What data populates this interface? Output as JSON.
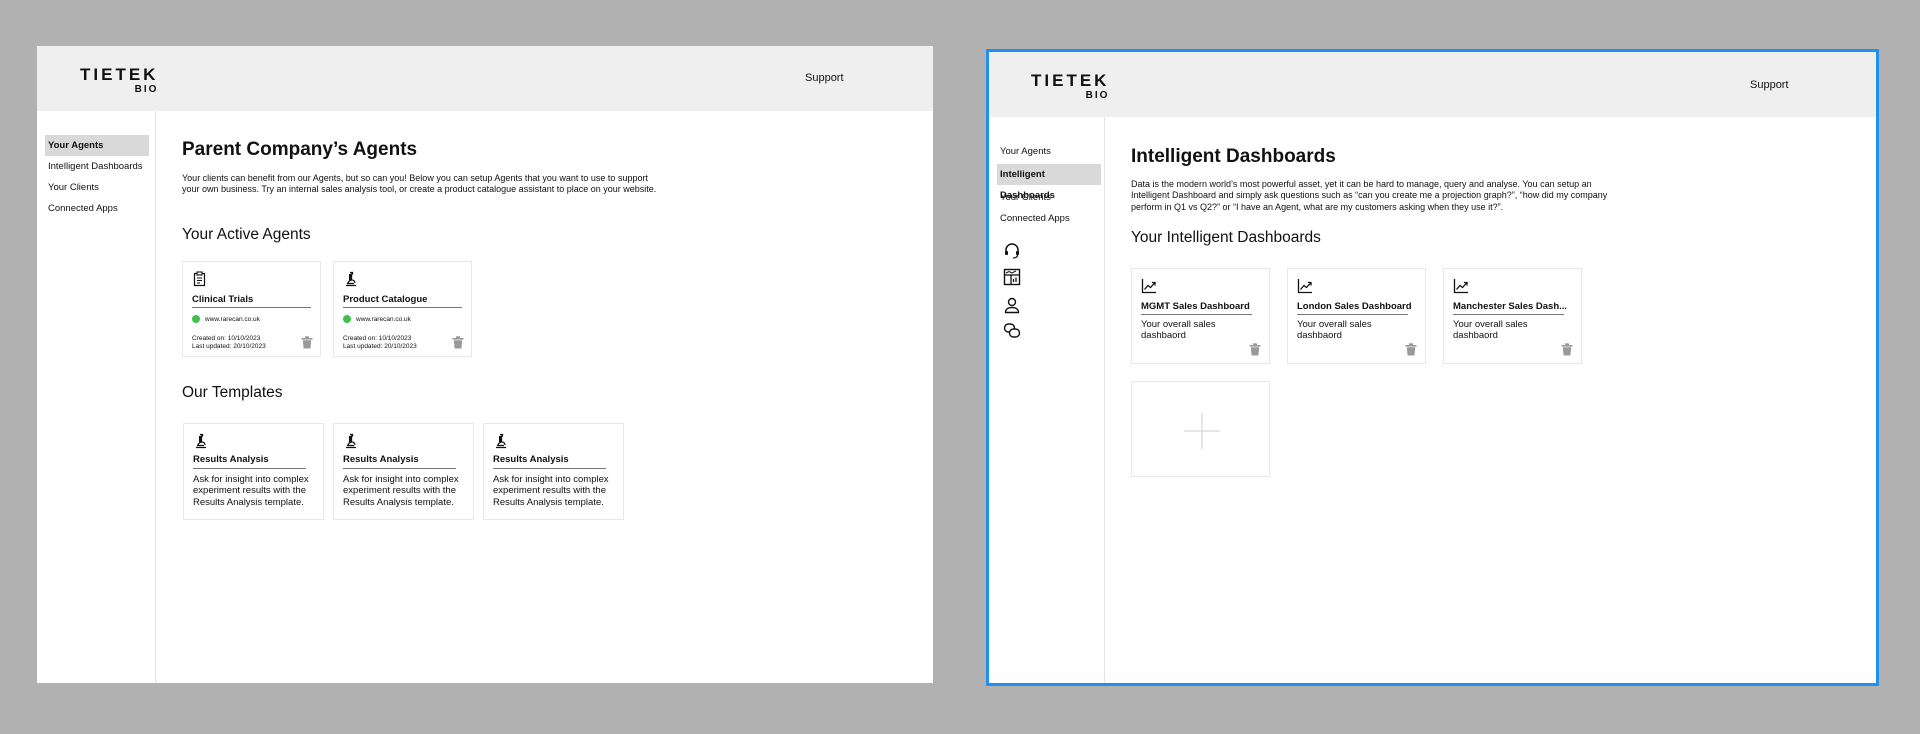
{
  "brand": {
    "line1": "TIETEK",
    "line2": "BIO"
  },
  "left": {
    "support": "Support",
    "nav": [
      "Your Agents",
      "Intelligent Dashboards",
      "Your Clients",
      "Connected Apps"
    ],
    "title": "Parent Company’s Agents",
    "description": "Your clients can benefit from our Agents, but so can you! Below you can setup Agents that you want to use to support your own business. Try an internal sales analysis tool, or create a product catalogue assistant to place on your website.",
    "active_heading": "Your Active Agents",
    "agents": [
      {
        "icon": "clipboard-icon",
        "title": "Clinical Trials",
        "site": "www.rarecan.co.uk",
        "created": "Created on: 10/10/2023",
        "updated": "Last updated: 20/10/2023",
        "status_color": "#3fc24c"
      },
      {
        "icon": "microscope-icon",
        "title": "Product Catalogue",
        "site": "www.rarecan.co.uk",
        "created": "Created on: 10/10/2023",
        "updated": "Last updated: 20/10/2023",
        "status_color": "#3fc24c"
      }
    ],
    "templates_heading": "Our Templates",
    "templates": [
      {
        "icon": "microscope-icon",
        "title": "Results Analysis",
        "body": "Ask for insight into complex experiment results with the Results Analysis template."
      },
      {
        "icon": "microscope-icon",
        "title": "Results Analysis",
        "body": "Ask for insight into complex experiment results with the Results Analysis template."
      },
      {
        "icon": "microscope-icon",
        "title": "Results Analysis",
        "body": "Ask for insight into complex experiment results with the Results Analysis template."
      }
    ]
  },
  "right": {
    "support": "Support",
    "nav": [
      "Your Agents",
      "Intelligent Dashboards",
      "Your Clients",
      "Connected Apps"
    ],
    "side_icons": [
      "headset-icon",
      "dashboard-icon",
      "user-icon",
      "chat-icon"
    ],
    "title": "Intelligent Dashboards",
    "description": "Data is the modern world’s most powerful asset, yet it can be hard to manage, query and analyse. You can setup an Intelligent Dashboard and simply ask questions such as “can you create me a projection graph?”, “how did my company perform in Q1 vs Q2?” or “I have an Agent, what are my customers asking when they use it?”.",
    "heading": "Your Intelligent Dashboards",
    "dashboards": [
      {
        "icon": "trend-chart-icon",
        "title": "MGMT Sales Dashboard",
        "body": "Your overall sales dashbaord"
      },
      {
        "icon": "trend-chart-icon",
        "title": "London Sales Dashboard",
        "body": "Your overall sales dashbaord"
      },
      {
        "icon": "trend-chart-icon",
        "title": "Manchester Sales Dash...",
        "body": "Your overall sales dashbaord"
      }
    ],
    "add_icon": "plus-icon"
  },
  "colors": {
    "frame_bg": "#ffffff",
    "page_bg": "#b1b1b1",
    "header_bg": "#efefef",
    "active_nav": "#d9d9d9",
    "status_green": "#3fc24c",
    "selection": "#1e90ee"
  }
}
